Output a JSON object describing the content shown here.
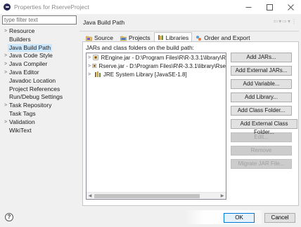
{
  "window": {
    "title": "Properties for RserveProject",
    "controls": [
      "minimize",
      "maximize",
      "close"
    ]
  },
  "sidebar": {
    "filter_placeholder": "type filter text",
    "items": [
      {
        "label": "Resource",
        "expandable": true
      },
      {
        "label": "Builders",
        "expandable": false
      },
      {
        "label": "Java Build Path",
        "expandable": false,
        "selected": true
      },
      {
        "label": "Java Code Style",
        "expandable": true
      },
      {
        "label": "Java Compiler",
        "expandable": true
      },
      {
        "label": "Java Editor",
        "expandable": true
      },
      {
        "label": "Javadoc Location",
        "expandable": false
      },
      {
        "label": "Project References",
        "expandable": false
      },
      {
        "label": "Run/Debug Settings",
        "expandable": false
      },
      {
        "label": "Task Repository",
        "expandable": true
      },
      {
        "label": "Task Tags",
        "expandable": false
      },
      {
        "label": "Validation",
        "expandable": true
      },
      {
        "label": "WikiText",
        "expandable": false
      }
    ]
  },
  "main": {
    "title": "Java Build Path",
    "tabs": [
      {
        "label": "Source",
        "icon": "source-folder-icon",
        "active": false
      },
      {
        "label": "Projects",
        "icon": "projects-icon",
        "active": false
      },
      {
        "label": "Libraries",
        "icon": "libraries-icon",
        "active": true
      },
      {
        "label": "Order and Export",
        "icon": "order-export-icon",
        "active": false
      }
    ],
    "list_label": "JARs and class folders on the build path:",
    "entries": [
      {
        "label": "REngine.jar - D:\\Program Files\\R\\R-3.3.1\\library\\R",
        "icon": "jar-icon"
      },
      {
        "label": "Rserve.jar - D:\\Program Files\\R\\R-3.3.1\\library\\Rse",
        "icon": "jar-icon"
      },
      {
        "label": "JRE System Library [JavaSE-1.8]",
        "icon": "library-icon"
      }
    ],
    "buttons": [
      {
        "label": "Add JARs...",
        "enabled": true
      },
      {
        "label": "Add External JARs...",
        "enabled": true
      },
      {
        "label": "Add Variable...",
        "enabled": true
      },
      {
        "label": "Add Library...",
        "enabled": true
      },
      {
        "label": "Add Class Folder...",
        "enabled": true
      },
      {
        "label": "Add External Class Folder...",
        "enabled": true
      },
      {
        "label": "Edit...",
        "enabled": false
      },
      {
        "label": "Remove",
        "enabled": false
      },
      {
        "label": "Migrate JAR File...",
        "enabled": false
      }
    ]
  },
  "footer": {
    "ok_label": "OK",
    "cancel_label": "Cancel"
  },
  "colors": {
    "selection": "#cce8ff",
    "default_button_border": "#0078d7"
  }
}
